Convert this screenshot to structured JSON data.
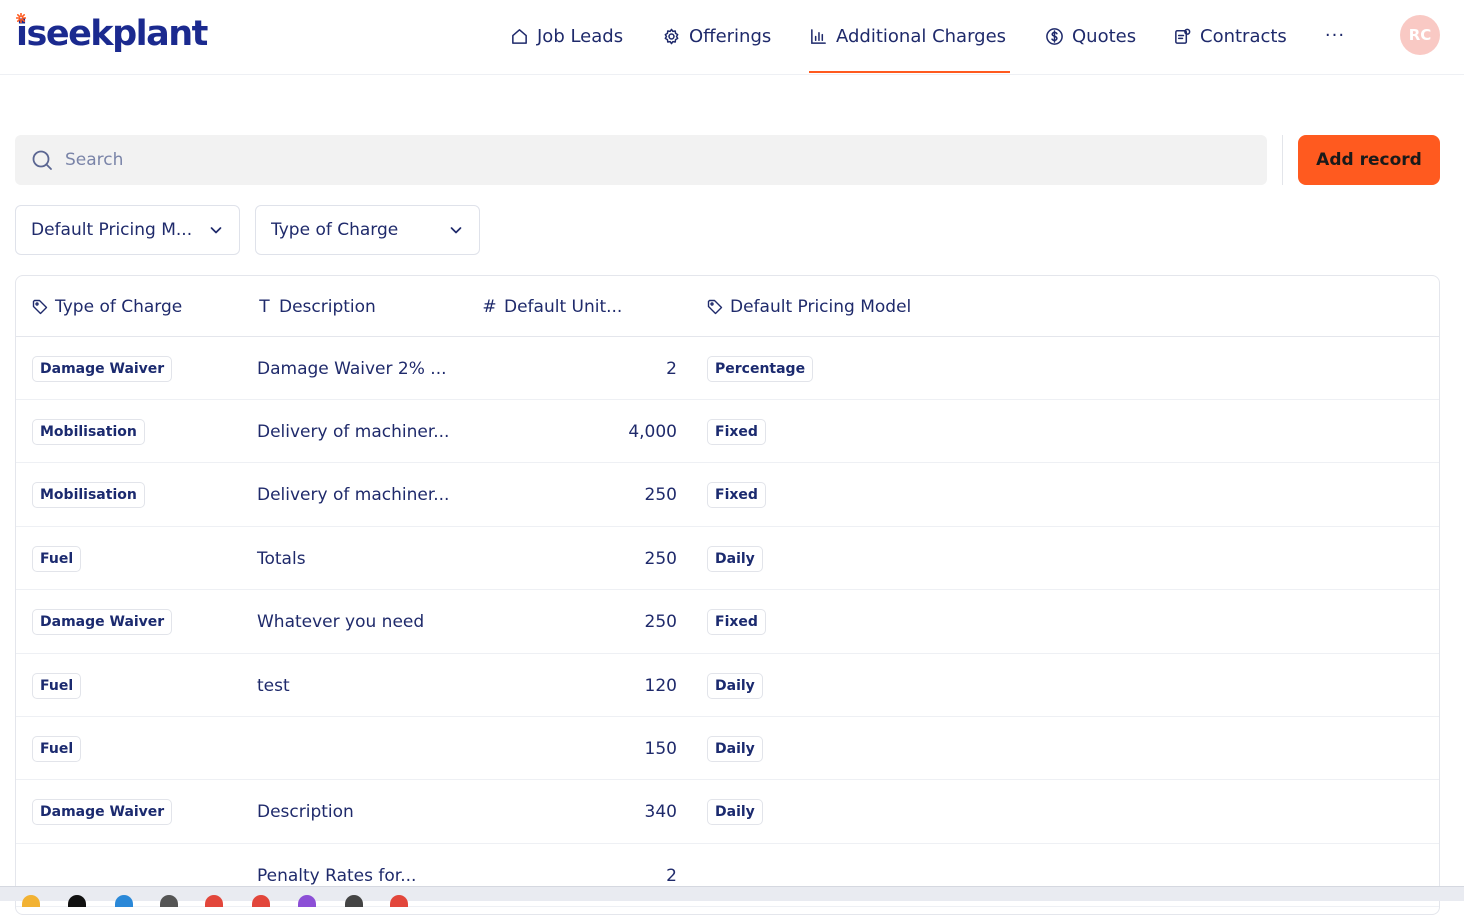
{
  "brand": {
    "logo_text": "iseekplant"
  },
  "nav": {
    "items": [
      {
        "label": "Job Leads",
        "icon": "home-icon"
      },
      {
        "label": "Offerings",
        "icon": "gear-icon"
      },
      {
        "label": "Additional Charges",
        "icon": "chart-icon",
        "active": true
      },
      {
        "label": "Quotes",
        "icon": "dollar-icon"
      },
      {
        "label": "Contracts",
        "icon": "contract-icon"
      }
    ],
    "more_label": "···",
    "avatar_initials": "RC"
  },
  "toolbar": {
    "search_placeholder": "Search",
    "add_button_label": "Add record"
  },
  "filters": {
    "pricing_model_label": "Default Pricing M...",
    "type_of_charge_label": "Type of Charge"
  },
  "table": {
    "headers": {
      "type_of_charge": "Type of Charge",
      "description": "Description",
      "default_unit": "Default Unit...",
      "pricing_model": "Default Pricing Model"
    },
    "rows": [
      {
        "type": "Damage Waiver",
        "description": "Damage Waiver 2% ...",
        "value": "2",
        "model": "Percentage"
      },
      {
        "type": "Mobilisation",
        "description": "Delivery of machiner...",
        "value": "4,000",
        "model": "Fixed"
      },
      {
        "type": "Mobilisation",
        "description": "Delivery of machiner...",
        "value": "250",
        "model": "Fixed"
      },
      {
        "type": "Fuel",
        "description": "Totals",
        "value": "250",
        "model": "Daily"
      },
      {
        "type": "Damage Waiver",
        "description": "Whatever you need",
        "value": "250",
        "model": "Fixed"
      },
      {
        "type": "Fuel",
        "description": "test",
        "value": "120",
        "model": "Daily"
      },
      {
        "type": "Fuel",
        "description": "",
        "value": "150",
        "model": "Daily"
      },
      {
        "type": "Damage Waiver",
        "description": "Description",
        "value": "340",
        "model": "Daily"
      },
      {
        "type": "",
        "description": "Penalty Rates for...",
        "value": "2",
        "model": ""
      }
    ]
  },
  "colors": {
    "accent": "#ff5a1f",
    "text": "#1f2a6b",
    "logo": "#1b2a8f"
  }
}
